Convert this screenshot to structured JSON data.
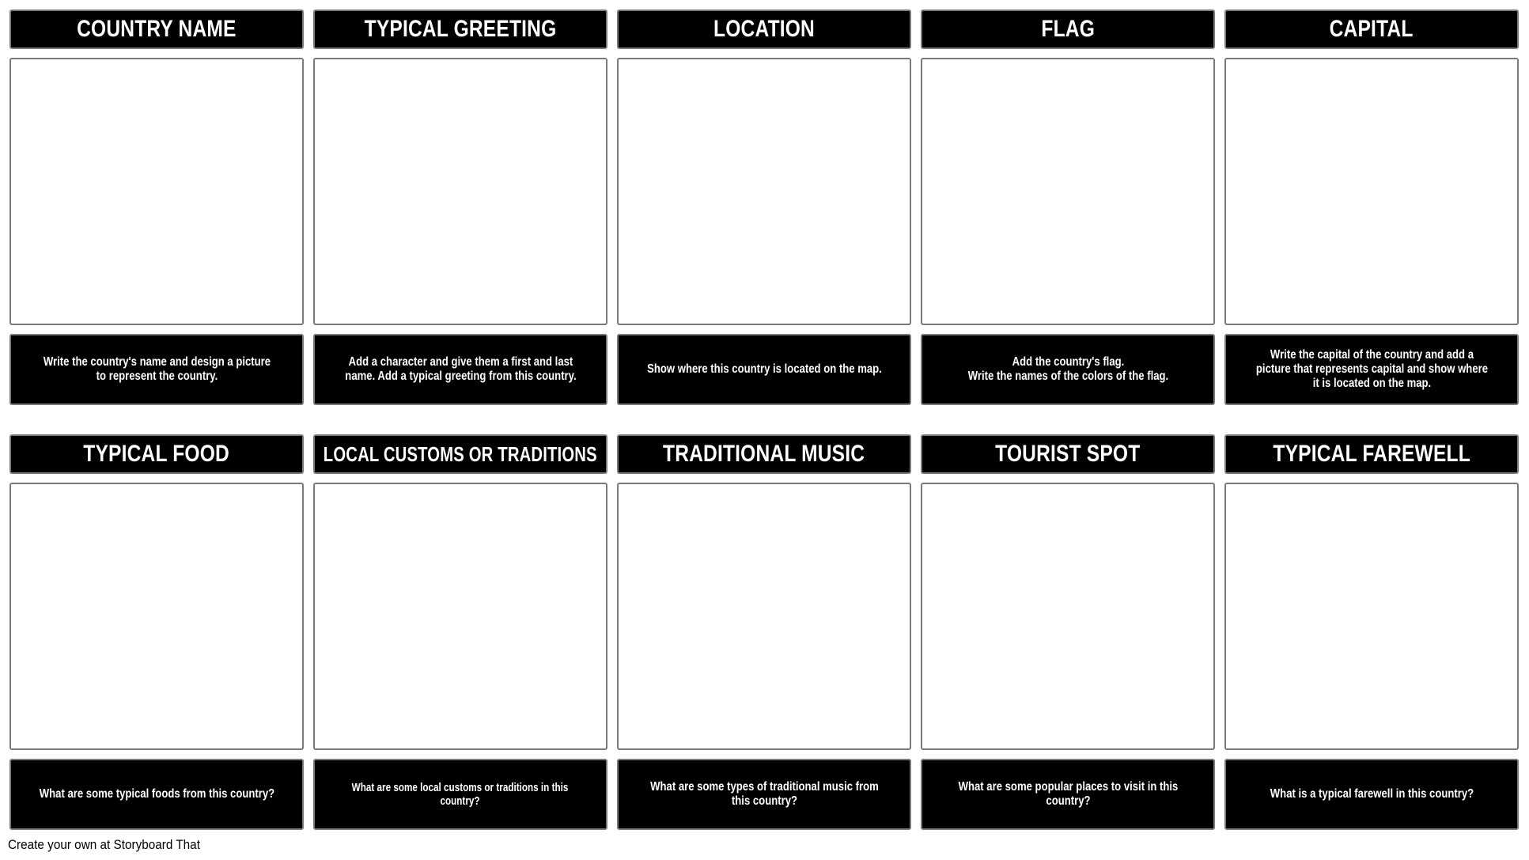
{
  "storyboard": {
    "row1": [
      {
        "title": "COUNTRY NAME",
        "caption": "Write the country's name and design a picture\nto represent the country."
      },
      {
        "title": "TYPICAL GREETING",
        "caption": "Add a character and give them a first and last\nname.  Add a typical greeting from this country."
      },
      {
        "title": "LOCATION",
        "caption": "Show where this country is located on the map."
      },
      {
        "title": "FLAG",
        "caption": "Add the country's flag.\nWrite the names of the colors of the flag."
      },
      {
        "title": "CAPITAL",
        "caption": "Write the capital of the country and add a\npicture that represents capital and show where\nit is located on the map."
      }
    ],
    "row2": [
      {
        "title": "TYPICAL FOOD",
        "caption": "What are some typical foods from this country?"
      },
      {
        "title": "LOCAL CUSTOMS OR TRADITIONS",
        "caption": "What are some local customs or traditions in this\ncountry?"
      },
      {
        "title": "TRADITIONAL MUSIC",
        "caption": "What are some types of traditional music from\nthis country?"
      },
      {
        "title": "TOURIST SPOT",
        "caption": "What are some popular places to visit in this\ncountry?"
      },
      {
        "title": "TYPICAL FAREWELL",
        "caption": "What is a typical farewell in this country?"
      }
    ]
  },
  "footer": {
    "text": "Create your own at Storyboard That"
  },
  "colors": {
    "header_bg": "#000000",
    "header_text": "#ffffff",
    "border": "#7a7a7a",
    "panel_bg": "#ffffff"
  }
}
